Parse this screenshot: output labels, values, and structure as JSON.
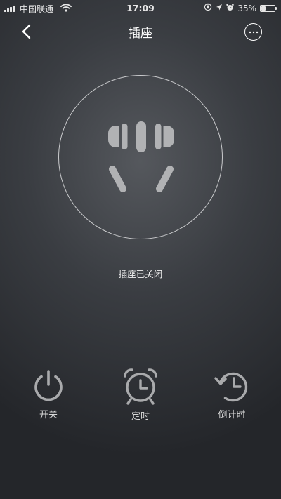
{
  "status_bar": {
    "carrier": "中国联通",
    "time": "17:09",
    "battery": "35%",
    "battery_level": 0.35,
    "icons": [
      "signal-icon",
      "wifi-icon",
      "screen-rotation-lock-icon",
      "location-icon",
      "alarm-icon",
      "battery-icon"
    ]
  },
  "header": {
    "title": "插座",
    "back_icon": "back-arrow-icon",
    "more_icon": "more-options-icon"
  },
  "socket": {
    "icon": "socket-plug-icon",
    "status_text": "插座已关闭"
  },
  "controls": [
    {
      "label": "开关",
      "icon": "power-icon"
    },
    {
      "label": "定时",
      "icon": "alarm-clock-icon"
    },
    {
      "label": "倒计时",
      "icon": "countdown-icon"
    }
  ],
  "colors": {
    "background": "#2e3034",
    "icon_gray": "#a9aaac",
    "text": "#ffffff"
  }
}
